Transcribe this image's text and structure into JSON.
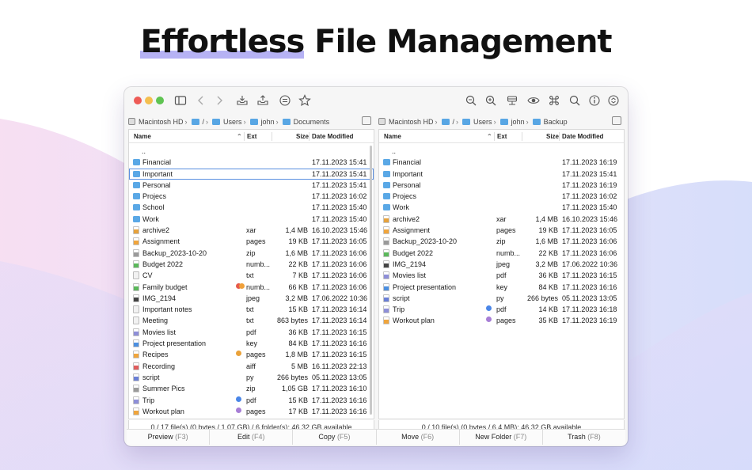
{
  "headline": {
    "part1": "Effortless",
    "part2": " File Management"
  },
  "colors": {
    "close": "#ee5b56",
    "minimize": "#f4bf4f",
    "zoom": "#5fc452",
    "accent": "#a9a4f2",
    "folder": "#5aa8e6"
  },
  "toolbar": {
    "left_icons": [
      "sidebar-icon",
      "back-icon",
      "forward-icon",
      "archive-icon",
      "share-icon",
      "list-menu-icon",
      "star-icon"
    ],
    "right_icons": [
      "zoom-out-icon",
      "zoom-in-icon",
      "drive-icon",
      "eye-icon",
      "command-icon",
      "search-icon",
      "info-icon",
      "sync-icon"
    ]
  },
  "columns": {
    "name": "Name",
    "ext": "Ext",
    "size": "Size",
    "date": "Date Modified"
  },
  "left_pane": {
    "path": [
      "Macintosh HD",
      "/",
      "Users",
      "john",
      "Documents"
    ],
    "rows": [
      {
        "icon": "none",
        "name": "..",
        "ext": "",
        "size": "",
        "date": "",
        "tag": ""
      },
      {
        "icon": "folder",
        "name": "Financial",
        "ext": "",
        "size": "",
        "date": "17.11.2023 15:41",
        "tag": ""
      },
      {
        "icon": "folder",
        "name": "Important",
        "ext": "",
        "size": "",
        "date": "17.11.2023 15:41",
        "tag": "",
        "selected": true
      },
      {
        "icon": "folder",
        "name": "Personal",
        "ext": "",
        "size": "",
        "date": "17.11.2023 15:41",
        "tag": ""
      },
      {
        "icon": "folder",
        "name": "Projecs",
        "ext": "",
        "size": "",
        "date": "17.11.2023 16:02",
        "tag": ""
      },
      {
        "icon": "folder",
        "name": "School",
        "ext": "",
        "size": "",
        "date": "17.11.2023 15:40",
        "tag": ""
      },
      {
        "icon": "folder",
        "name": "Work",
        "ext": "",
        "size": "",
        "date": "17.11.2023 15:40",
        "tag": ""
      },
      {
        "icon": "archive",
        "name": "archive2",
        "ext": "xar",
        "size": "1,4 MB",
        "date": "16.10.2023 15:46",
        "tag": ""
      },
      {
        "icon": "pages",
        "name": "Assignment",
        "ext": "pages",
        "size": "19 KB",
        "date": "17.11.2023 16:05",
        "tag": ""
      },
      {
        "icon": "zip",
        "name": "Backup_2023-10-20",
        "ext": "zip",
        "size": "1,6 MB",
        "date": "17.11.2023 16:06",
        "tag": ""
      },
      {
        "icon": "numbers",
        "name": "Budget 2022",
        "ext": "numb...",
        "size": "22 KB",
        "date": "17.11.2023 16:06",
        "tag": ""
      },
      {
        "icon": "doc",
        "name": "CV",
        "ext": "txt",
        "size": "7 KB",
        "date": "17.11.2023 16:06",
        "tag": ""
      },
      {
        "icon": "numbers",
        "name": "Family budget",
        "ext": "numb...",
        "size": "66 KB",
        "date": "17.11.2023 16:06",
        "tag": "red-orange"
      },
      {
        "icon": "image",
        "name": "IMG_2194",
        "ext": "jpeg",
        "size": "3,2 MB",
        "date": "17.06.2022 10:36",
        "tag": ""
      },
      {
        "icon": "doc",
        "name": "Important notes",
        "ext": "txt",
        "size": "15 KB",
        "date": "17.11.2023 16:14",
        "tag": ""
      },
      {
        "icon": "doc",
        "name": "Meeting",
        "ext": "txt",
        "size": "863 bytes",
        "date": "17.11.2023 16:14",
        "tag": ""
      },
      {
        "icon": "pdf",
        "name": "Movies list",
        "ext": "pdf",
        "size": "36 KB",
        "date": "17.11.2023 16:15",
        "tag": ""
      },
      {
        "icon": "key",
        "name": "Project presentation",
        "ext": "key",
        "size": "84 KB",
        "date": "17.11.2023 16:16",
        "tag": ""
      },
      {
        "icon": "pages",
        "name": "Recipes",
        "ext": "pages",
        "size": "1,8 MB",
        "date": "17.11.2023 16:15",
        "tag": "orange"
      },
      {
        "icon": "audio",
        "name": "Recording",
        "ext": "aiff",
        "size": "5 MB",
        "date": "16.11.2023 22:13",
        "tag": ""
      },
      {
        "icon": "py",
        "name": "script",
        "ext": "py",
        "size": "266 bytes",
        "date": "05.11.2023 13:05",
        "tag": ""
      },
      {
        "icon": "zip",
        "name": "Summer Pics",
        "ext": "zip",
        "size": "1,05 GB",
        "date": "17.11.2023 16:10",
        "tag": ""
      },
      {
        "icon": "pdf",
        "name": "Trip",
        "ext": "pdf",
        "size": "15 KB",
        "date": "17.11.2023 16:16",
        "tag": "blue"
      },
      {
        "icon": "pages",
        "name": "Workout plan",
        "ext": "pages",
        "size": "17 KB",
        "date": "17.11.2023 16:16",
        "tag": "purple"
      }
    ],
    "status": "0 / 17 file(s) (0 bytes / 1,07 GB) / 6 folder(s); 46,32 GB available"
  },
  "right_pane": {
    "path": [
      "Macintosh HD",
      "/",
      "Users",
      "john",
      "Backup"
    ],
    "rows": [
      {
        "icon": "none",
        "name": "..",
        "ext": "",
        "size": "",
        "date": "",
        "tag": ""
      },
      {
        "icon": "folder",
        "name": "Financial",
        "ext": "",
        "size": "",
        "date": "17.11.2023 16:19",
        "tag": ""
      },
      {
        "icon": "folder",
        "name": "Important",
        "ext": "",
        "size": "",
        "date": "17.11.2023 15:41",
        "tag": ""
      },
      {
        "icon": "folder",
        "name": "Personal",
        "ext": "",
        "size": "",
        "date": "17.11.2023 16:19",
        "tag": ""
      },
      {
        "icon": "folder",
        "name": "Projecs",
        "ext": "",
        "size": "",
        "date": "17.11.2023 16:02",
        "tag": ""
      },
      {
        "icon": "folder",
        "name": "Work",
        "ext": "",
        "size": "",
        "date": "17.11.2023 15:40",
        "tag": ""
      },
      {
        "icon": "archive",
        "name": "archive2",
        "ext": "xar",
        "size": "1,4 MB",
        "date": "16.10.2023 15:46",
        "tag": ""
      },
      {
        "icon": "pages",
        "name": "Assignment",
        "ext": "pages",
        "size": "19 KB",
        "date": "17.11.2023 16:05",
        "tag": ""
      },
      {
        "icon": "zip",
        "name": "Backup_2023-10-20",
        "ext": "zip",
        "size": "1,6 MB",
        "date": "17.11.2023 16:06",
        "tag": ""
      },
      {
        "icon": "numbers",
        "name": "Budget 2022",
        "ext": "numb...",
        "size": "22 KB",
        "date": "17.11.2023 16:06",
        "tag": ""
      },
      {
        "icon": "image",
        "name": "IMG_2194",
        "ext": "jpeg",
        "size": "3,2 MB",
        "date": "17.06.2022 10:36",
        "tag": ""
      },
      {
        "icon": "pdf",
        "name": "Movies list",
        "ext": "pdf",
        "size": "36 KB",
        "date": "17.11.2023 16:15",
        "tag": ""
      },
      {
        "icon": "key",
        "name": "Project presentation",
        "ext": "key",
        "size": "84 KB",
        "date": "17.11.2023 16:16",
        "tag": ""
      },
      {
        "icon": "py",
        "name": "script",
        "ext": "py",
        "size": "266 bytes",
        "date": "05.11.2023 13:05",
        "tag": ""
      },
      {
        "icon": "pdf",
        "name": "Trip",
        "ext": "pdf",
        "size": "14 KB",
        "date": "17.11.2023 16:18",
        "tag": "blue"
      },
      {
        "icon": "pages",
        "name": "Workout plan",
        "ext": "pages",
        "size": "35 KB",
        "date": "17.11.2023 16:19",
        "tag": "purple"
      }
    ],
    "status": "0 / 10 file(s) (0 bytes / 6,4 MB); 46,32 GB available"
  },
  "function_bar": [
    {
      "label": "Preview",
      "key": "(F3)"
    },
    {
      "label": "Edit",
      "key": "(F4)"
    },
    {
      "label": "Copy",
      "key": "(F5)"
    },
    {
      "label": "Move",
      "key": "(F6)"
    },
    {
      "label": "New Folder",
      "key": "(F7)"
    },
    {
      "label": "Trash",
      "key": "(F8)"
    }
  ]
}
